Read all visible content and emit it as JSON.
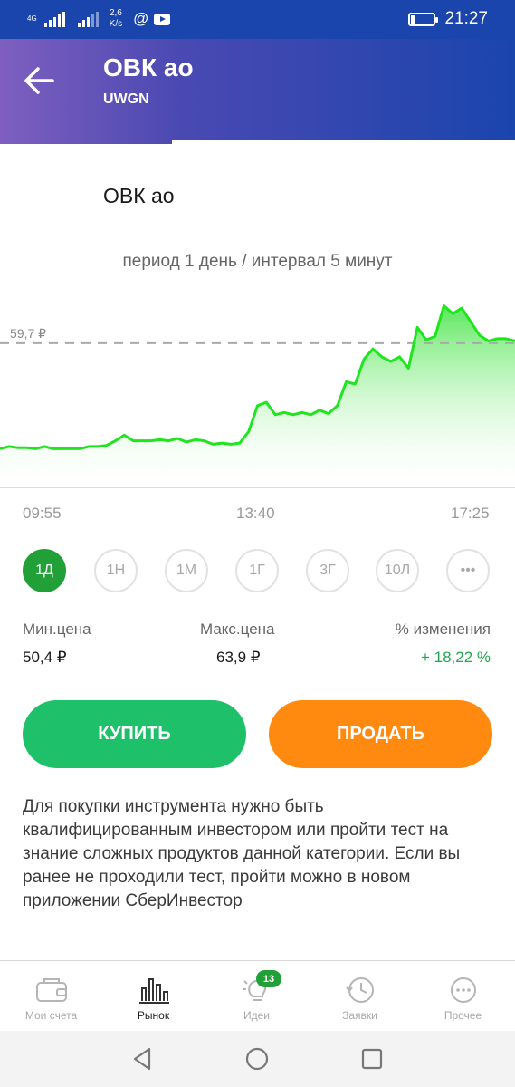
{
  "status_bar": {
    "network_tag": "4G",
    "speed_value": "2,6",
    "speed_unit": "K/s",
    "time": "21:27"
  },
  "header": {
    "title": "ОВК ао",
    "ticker": "UWGN"
  },
  "instrument_name": "ОВК ао",
  "chart": {
    "period_label": "период 1 день / интервал 5 минут",
    "ref_price_label": "59,7 ₽",
    "x_ticks": [
      "09:55",
      "13:40",
      "17:25"
    ]
  },
  "chart_data": {
    "type": "area",
    "title": "",
    "xlabel": "",
    "ylabel": "",
    "x_range": [
      "09:55",
      "17:25"
    ],
    "reference_line": 59.7,
    "ylim": [
      47,
      66
    ],
    "series": [
      {
        "values": [
          50.4,
          50.6,
          50.5,
          50.5,
          50.4,
          50.6,
          50.4,
          50.4,
          50.4,
          50.4,
          50.6,
          50.6,
          50.7,
          51.1,
          51.6,
          51.1,
          51.1,
          51.1,
          51.2,
          51.1,
          51.3,
          51.0,
          51.2,
          51.1,
          50.8,
          50.9,
          50.8,
          50.9,
          51.9,
          54.2,
          54.5,
          53.4,
          53.6,
          53.4,
          53.6,
          53.4,
          53.8,
          53.5,
          54.2,
          56.3,
          56.1,
          58.3,
          59.2,
          58.5,
          58.1,
          58.5,
          57.5,
          61.1,
          60.0,
          60.3,
          63.0,
          62.3,
          62.8,
          61.6,
          60.4,
          59.9,
          60.1,
          60.1,
          59.9
        ]
      }
    ]
  },
  "periods": [
    "1Д",
    "1Н",
    "1М",
    "1Г",
    "3Г",
    "10Л",
    "•••"
  ],
  "active_period": "1Д",
  "stats": {
    "min_label": "Мин.цена",
    "min_value": "50,4 ₽",
    "max_label": "Макс.цена",
    "max_value": "63,9 ₽",
    "change_label": "% изменения",
    "change_value": "+ 18,22 %"
  },
  "actions": {
    "buy": "КУПИТЬ",
    "sell": "ПРОДАТЬ"
  },
  "notice": "Для покупки инструмента нужно быть квалифицированным инвестором или пройти тест на знание сложных продуктов данной категории. Если вы ранее не проходили тест, пройти можно в новом приложении СберИнвестор",
  "bottom_nav": {
    "items": [
      {
        "label": "Мои счета",
        "icon": "wallet-icon"
      },
      {
        "label": "Рынок",
        "icon": "market-icon"
      },
      {
        "label": "Идеи",
        "icon": "lightbulb-icon"
      },
      {
        "label": "Заявки",
        "icon": "orders-clock-icon"
      },
      {
        "label": "Прочее",
        "icon": "more-icon"
      }
    ],
    "active": "Рынок",
    "ideas_badge": "13"
  },
  "colors": {
    "accent_green": "#21a038",
    "buy_green": "#1fc06a",
    "sell_orange": "#ff8a0f",
    "chart_line": "#1fe51f",
    "header_blue": "#1a45ad",
    "header_purple": "#7e5fbf"
  }
}
